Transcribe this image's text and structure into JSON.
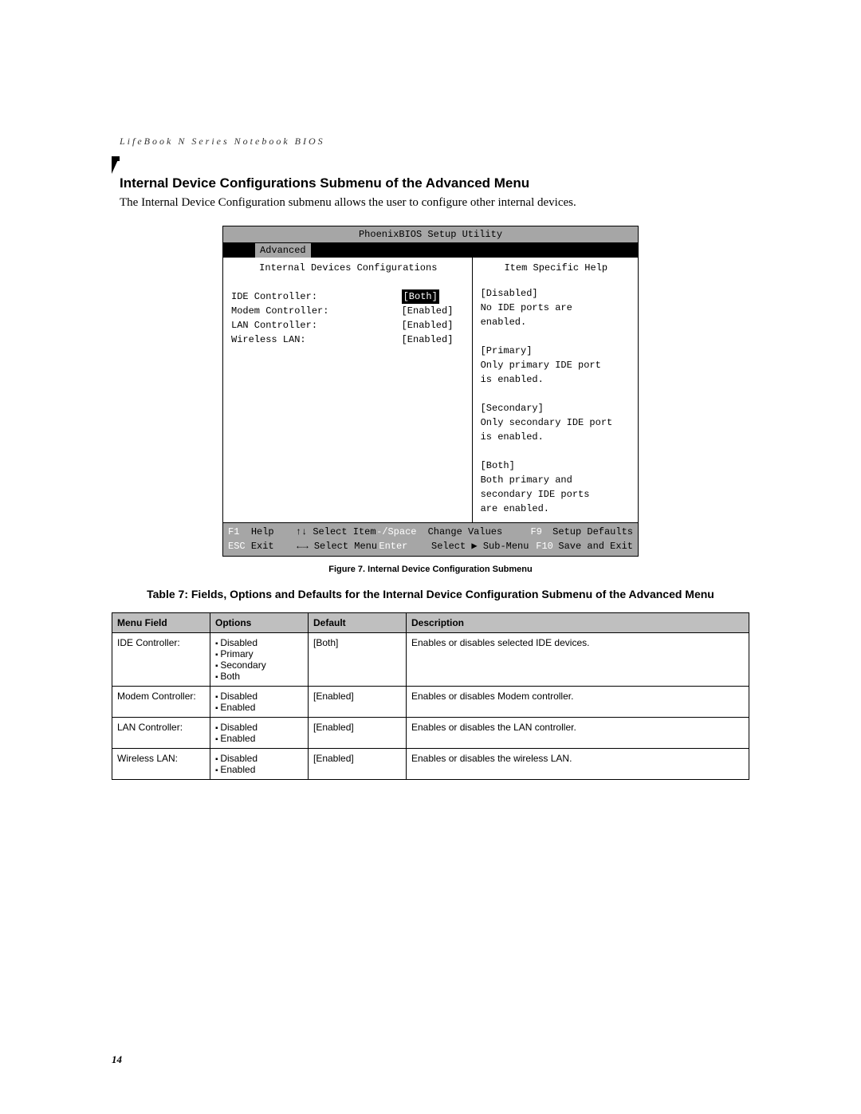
{
  "running_head": "LifeBook N Series Notebook BIOS",
  "section_title": "Internal Device Configurations Submenu of the Advanced Menu",
  "intro": "The Internal Device Configuration submenu allows the user to configure other internal devices.",
  "bios": {
    "title": "PhoenixBIOS Setup Utility",
    "tab": "Advanced",
    "subtitle": "Internal Devices Configurations",
    "help_title": "Item Specific Help",
    "fields": [
      {
        "label": "IDE Controller:",
        "value": "[Both]",
        "selected": true
      },
      {
        "label": "Modem Controller:",
        "value": "[Enabled]",
        "selected": false
      },
      {
        "label": "LAN Controller:",
        "value": "[Enabled]",
        "selected": false
      },
      {
        "label": "Wireless LAN:",
        "value": "[Enabled]",
        "selected": false
      }
    ],
    "help_text": "[Disabled]\nNo IDE ports are\nenabled.\n\n[Primary]\nOnly primary IDE port\nis enabled.\n\n[Secondary]\nOnly secondary IDE port\nis enabled.\n\n[Both]\nBoth primary and\nsecondary IDE ports\nare enabled.",
    "footer": {
      "r1": {
        "k1": "F1",
        "t1": "Help",
        "a1": "↑↓",
        "t2": "Select Item",
        "k2": "-/Space",
        "t3": "Change Values",
        "k3": "F9",
        "t4": "Setup Defaults"
      },
      "r2": {
        "k1": "ESC",
        "t1": "Exit",
        "a1": "←→",
        "t2": "Select Menu",
        "k2": "Enter",
        "t3": "Select ▶ Sub-Menu",
        "k3": "F10",
        "t4": "Save and Exit"
      }
    }
  },
  "figure_caption": "Figure 7.  Internal Device Configuration Submenu",
  "table_caption": "Table 7: Fields, Options and Defaults for the Internal Device Configuration Submenu of the Advanced Menu",
  "table": {
    "headers": [
      "Menu Field",
      "Options",
      "Default",
      "Description"
    ],
    "rows": [
      {
        "field": "IDE Controller:",
        "options": [
          "Disabled",
          "Primary",
          "Secondary",
          "Both"
        ],
        "default_": "[Both]",
        "desc": "Enables or disables selected IDE devices."
      },
      {
        "field": "Modem Controller:",
        "options": [
          "Disabled",
          "Enabled"
        ],
        "default_": "[Enabled]",
        "desc": "Enables or disables Modem controller."
      },
      {
        "field": "LAN Controller:",
        "options": [
          "Disabled",
          "Enabled"
        ],
        "default_": "[Enabled]",
        "desc": "Enables or disables the LAN controller."
      },
      {
        "field": "Wireless LAN:",
        "options": [
          "Disabled",
          "Enabled"
        ],
        "default_": "[Enabled]",
        "desc": "Enables or disables the wireless LAN."
      }
    ]
  },
  "page_number": "14"
}
